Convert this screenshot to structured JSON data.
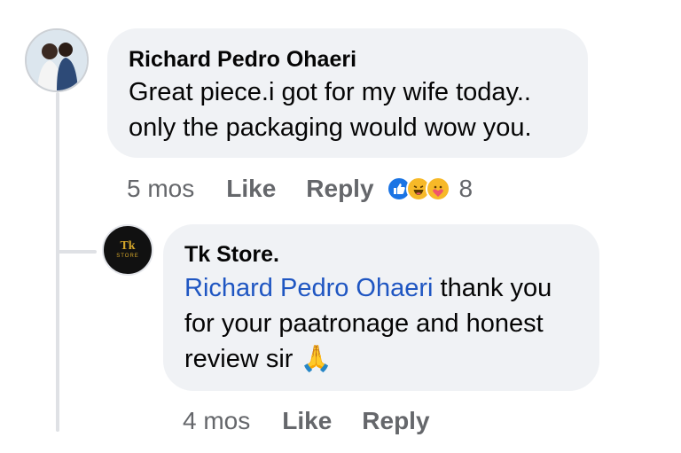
{
  "comments": [
    {
      "author": "Richard Pedro Ohaeri",
      "text_lines": [
        "Great piece.i got for my wife today..",
        "only the packaging would wow you."
      ],
      "time": "5 mos",
      "like_label": "Like",
      "reply_label": "Reply",
      "reactions": {
        "icons": [
          "like-icon",
          "haha-icon",
          "care-icon"
        ],
        "count": "8"
      }
    }
  ],
  "reply": {
    "author": "Tk Store.",
    "avatar_logo": "Tk",
    "avatar_sub": "STORE",
    "mention": "Richard Pedro Ohaeri",
    "text_lines": [
      " thank you",
      "for your paatronage and honest",
      "review sir "
    ],
    "emoji": "🙏",
    "time": "4 mos",
    "like_label": "Like",
    "reply_label": "Reply"
  },
  "colors": {
    "bubble": "#f0f2f5",
    "mention": "#1f56c2",
    "meta": "#65676b",
    "like": "#1b74e4",
    "haha": "#f7b928"
  }
}
